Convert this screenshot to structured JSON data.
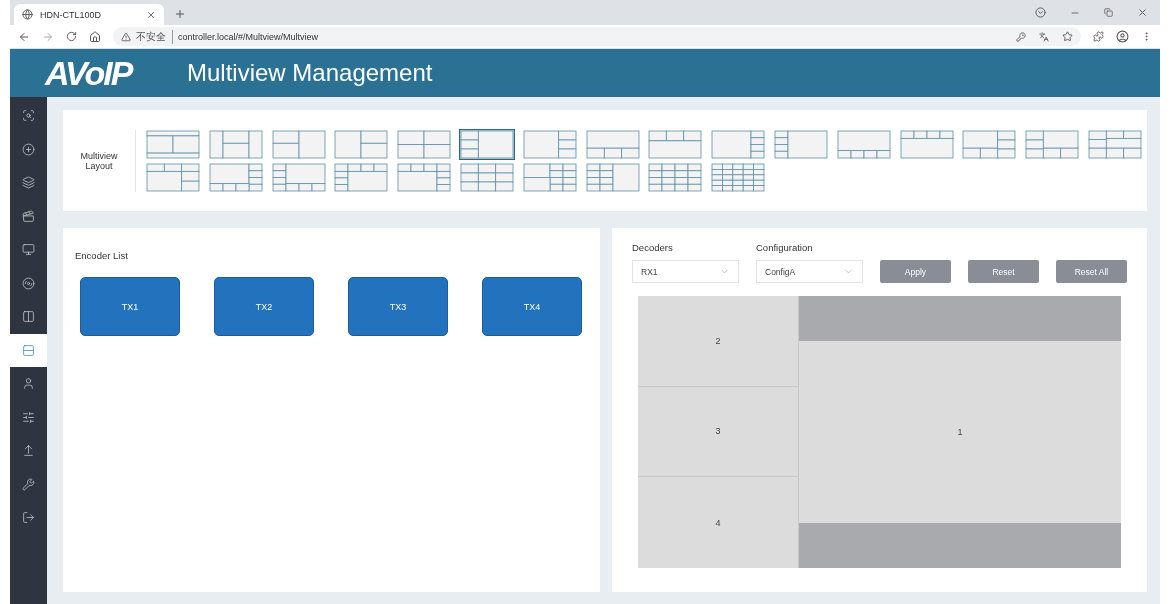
{
  "browser": {
    "tab_title": "HDN-CTL100D",
    "security_label": "不安全",
    "url": "controller.local/#/Multview/Multview"
  },
  "header": {
    "logo": "AVoIP",
    "title": "Multiview Management"
  },
  "sidebar": {
    "items": [
      {
        "selected": false
      },
      {
        "selected": false
      },
      {
        "selected": false
      },
      {
        "selected": false
      },
      {
        "selected": false
      },
      {
        "selected": false
      },
      {
        "selected": false
      },
      {
        "selected": true
      },
      {
        "selected": false
      },
      {
        "selected": false
      },
      {
        "selected": false
      },
      {
        "selected": false
      },
      {
        "selected": false
      }
    ]
  },
  "layout_picker": {
    "label": "Multiview Layout",
    "layouts": [
      {
        "selected": false
      },
      {
        "selected": false
      },
      {
        "selected": false
      },
      {
        "selected": false
      },
      {
        "selected": false
      },
      {
        "selected": true
      },
      {
        "selected": false
      },
      {
        "selected": false
      },
      {
        "selected": false
      },
      {
        "selected": false
      },
      {
        "selected": false
      },
      {
        "selected": false
      },
      {
        "selected": false
      },
      {
        "selected": false
      },
      {
        "selected": false
      },
      {
        "selected": false
      },
      {
        "selected": false
      },
      {
        "selected": false
      },
      {
        "selected": false
      },
      {
        "selected": false
      },
      {
        "selected": false
      },
      {
        "selected": false
      },
      {
        "selected": false
      },
      {
        "selected": false
      },
      {
        "selected": false
      },
      {
        "selected": false
      }
    ]
  },
  "encoder_list": {
    "title": "Encoder List",
    "encoders": [
      "TX1",
      "TX2",
      "TX3",
      "TX4"
    ]
  },
  "decoder_panel": {
    "decoders": {
      "label": "Decoders",
      "value": "RX1"
    },
    "configuration": {
      "label": "Configuration",
      "value": "ConfigA"
    },
    "buttons": [
      "Apply",
      "Reset",
      "Reset All"
    ],
    "preview": {
      "side_windows": [
        "2",
        "3",
        "4"
      ],
      "main_window": "1"
    }
  }
}
